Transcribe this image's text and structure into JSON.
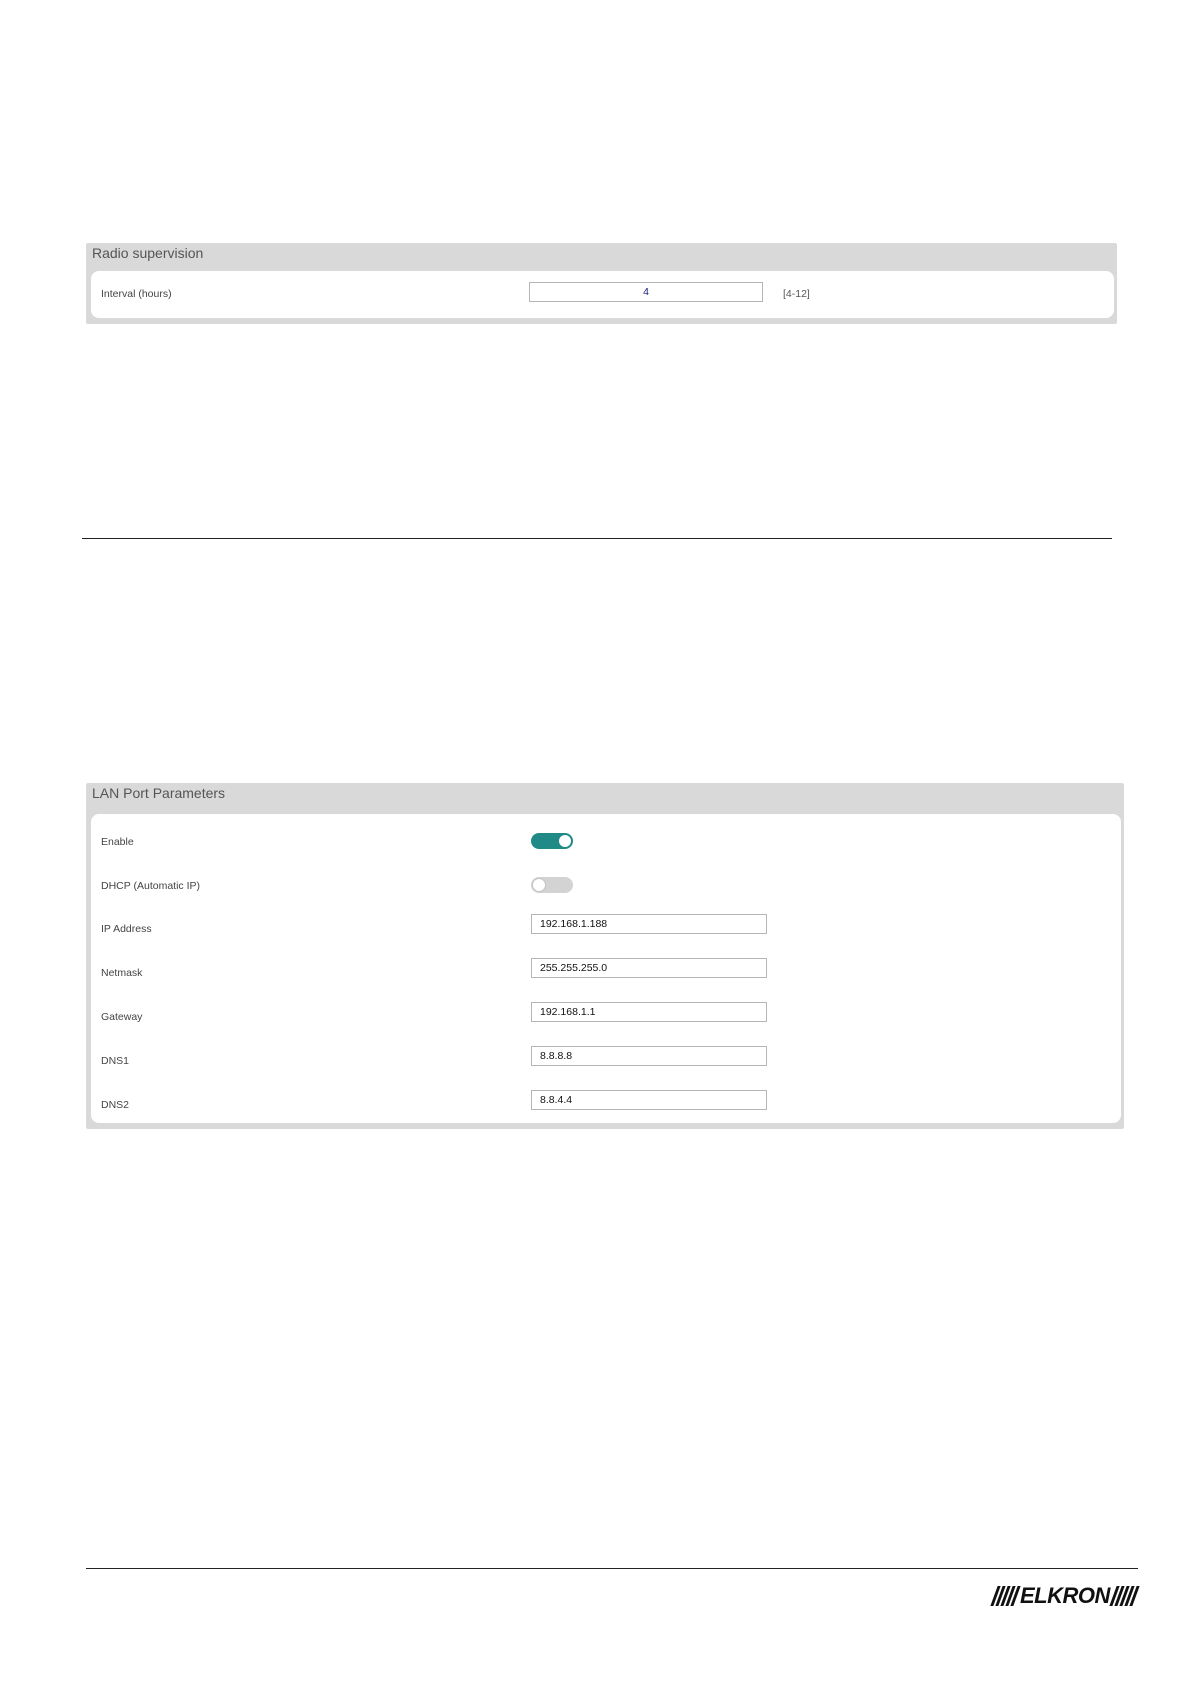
{
  "radio_supervision": {
    "title": "Radio supervision",
    "interval_label": "Interval (hours)",
    "interval_value": "4",
    "interval_range": "[4-12]"
  },
  "lan_port": {
    "title": "LAN Port Parameters",
    "enable_label": "Enable",
    "enable_state": true,
    "dhcp_label": "DHCP (Automatic IP)",
    "dhcp_state": false,
    "ip_label": "IP Address",
    "ip_value": "192.168.1.188",
    "netmask_label": "Netmask",
    "netmask_value": "255.255.255.0",
    "gateway_label": "Gateway",
    "gateway_value": "192.168.1.1",
    "dns1_label": "DNS1",
    "dns1_value": "8.8.8.8",
    "dns2_label": "DNS2",
    "dns2_value": "8.8.4.4"
  },
  "footer": {
    "logo_text": "ELKRON"
  },
  "colors": {
    "toggle_on": "#1f8a86",
    "panel_bg": "#d9d9d9"
  }
}
